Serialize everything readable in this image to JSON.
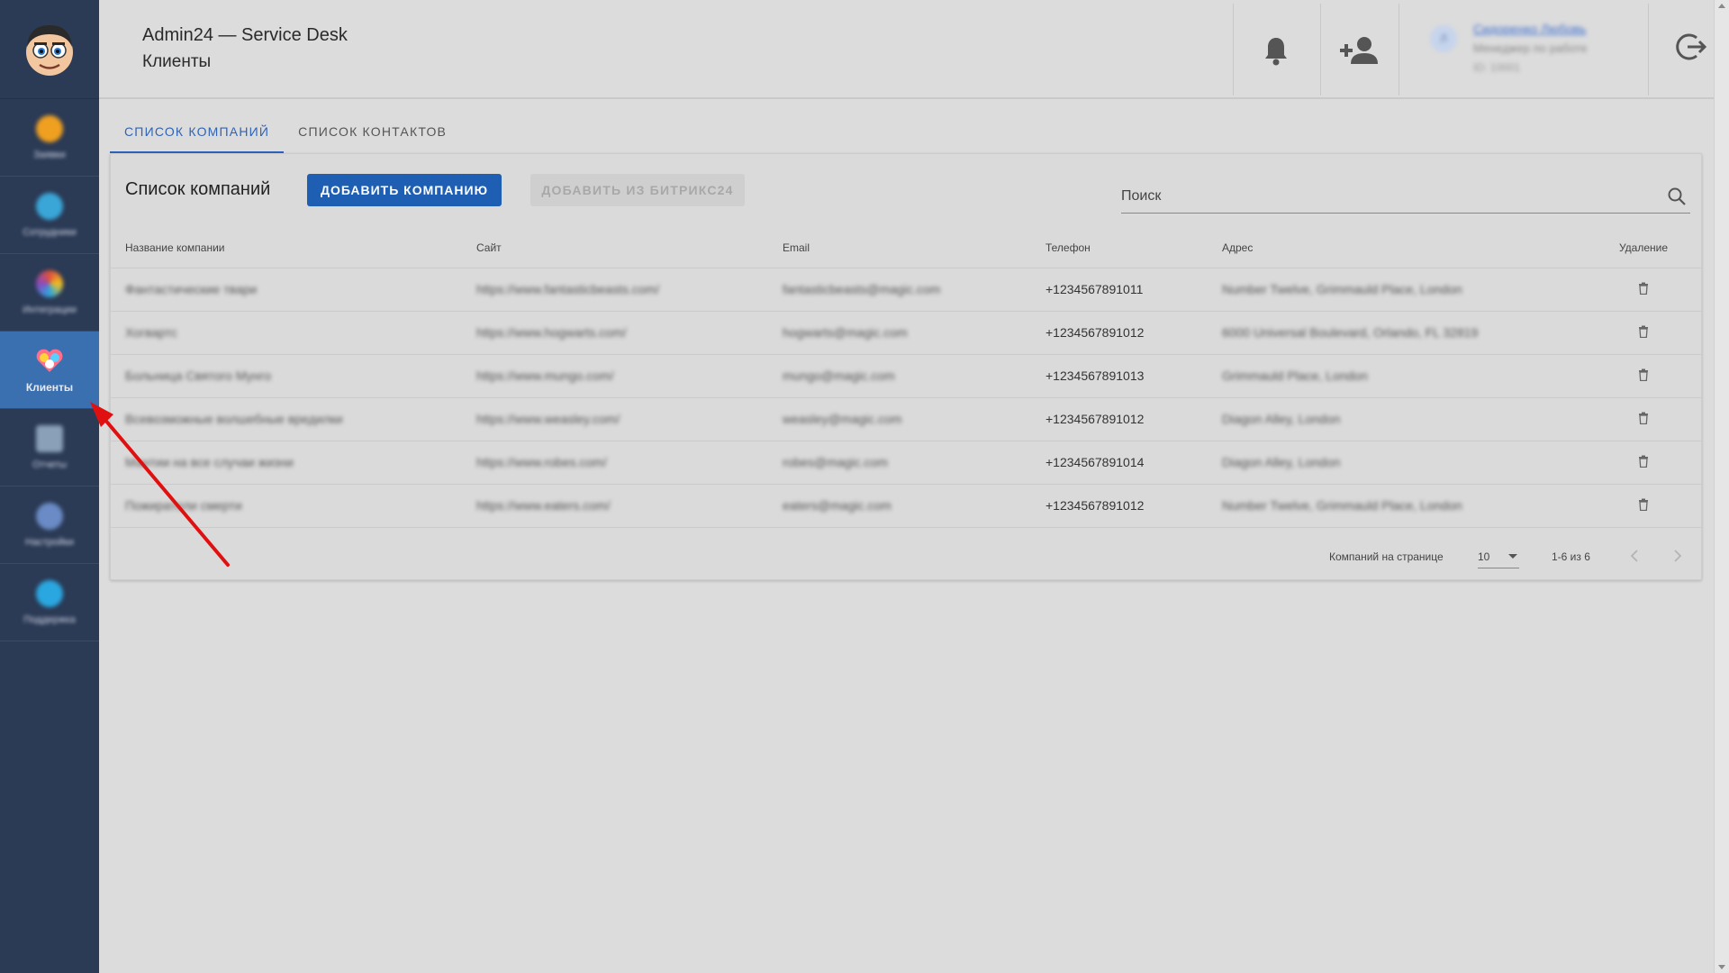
{
  "header": {
    "app_title": "Admin24 — Service Desk",
    "page_title": "Клиенты",
    "user": {
      "initials": "Л",
      "name": "Сидоренко Любовь",
      "role": "Менеджер по работе",
      "id": "ID: 10001"
    }
  },
  "sidebar": {
    "items": [
      {
        "label": "Заявки",
        "icon": "tickets-icon",
        "color": "#f0a020"
      },
      {
        "label": "Сотрудники",
        "icon": "employees-icon",
        "color": "#3aa6d8"
      },
      {
        "label": "Интеграции",
        "icon": "integrations-icon",
        "color": "#e0503a"
      },
      {
        "label": "Клиенты",
        "icon": "clients-icon",
        "color": "#ff6e8a"
      },
      {
        "label": "Отчеты",
        "icon": "reports-icon",
        "color": "#8aa0b8"
      },
      {
        "label": "Настройки",
        "icon": "settings-icon",
        "color": "#6a8bc6"
      },
      {
        "label": "Поддержка",
        "icon": "support-icon",
        "color": "#2aa7e0"
      }
    ]
  },
  "tabs": [
    {
      "label": "Список компаний",
      "active": true
    },
    {
      "label": "Список контактов",
      "active": false
    }
  ],
  "card": {
    "title": "Список компаний",
    "add_button": "Добавить компанию",
    "add_bitrix_button": "Добавить из Битрикс24",
    "search_placeholder": "Поиск"
  },
  "table": {
    "columns": [
      "Название компании",
      "Сайт",
      "Email",
      "Телефон",
      "Адрес",
      "Удаление"
    ],
    "rows": [
      {
        "name": "Фантастические твари",
        "site": "https://www.fantasticbeasts.com/",
        "email": "fantasticbeasts@magic.com",
        "phone": "+1234567891011",
        "address": "Number Twelve, Grimmauld Place, London"
      },
      {
        "name": "Хогвартс",
        "site": "https://www.hogwarts.com/",
        "email": "hogwarts@magic.com",
        "phone": "+1234567891012",
        "address": "6000 Universal Boulevard, Orlando, FL 32819"
      },
      {
        "name": "Больница Святого Мунго",
        "site": "https://www.mungo.com/",
        "email": "mungo@magic.com",
        "phone": "+1234567891013",
        "address": "Grimmauld Place, London"
      },
      {
        "name": "Всевозможные волшебные вредилки",
        "site": "https://www.weasley.com/",
        "email": "weasley@magic.com",
        "phone": "+1234567891012",
        "address": "Diagon Alley, London"
      },
      {
        "name": "Мантии на все случаи жизни",
        "site": "https://www.robes.com/",
        "email": "robes@magic.com",
        "phone": "+1234567891014",
        "address": "Diagon Alley, London"
      },
      {
        "name": "Пожиратели смерти",
        "site": "https://www.eaters.com/",
        "email": "eaters@magic.com",
        "phone": "+1234567891012",
        "address": "Number Twelve, Grimmauld Place, London"
      }
    ]
  },
  "pagination": {
    "rows_per_page_label": "Компаний на странице",
    "rows_per_page_value": "10",
    "range": "1-6 из 6"
  },
  "colors": {
    "sidebar_bg": "#2b3a55",
    "active_item": "#3a6fb0",
    "primary": "#1e5fb3",
    "annotation_arrow": "#e01010"
  }
}
